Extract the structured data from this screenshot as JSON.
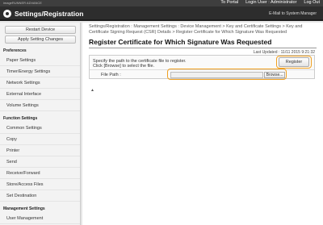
{
  "header": {
    "device_text": "imageRUNNER ADVANCE",
    "to_portal": "To Portal",
    "login_user_label": "Login User :",
    "login_user": "Administrator",
    "logout": "Log Out",
    "app_title": "Settings/Registration",
    "email_link": "E-Mail to System Manager"
  },
  "sidebar": {
    "restart_label": "Restart Device",
    "apply_label": "Apply Setting Changes",
    "sections": [
      {
        "title": "Preferences",
        "items": [
          "Paper Settings",
          "Timer/Energy Settings",
          "Network Settings",
          "External Interface",
          "Volume Settings"
        ]
      },
      {
        "title": "Function Settings",
        "items": [
          "Common Settings",
          "Copy",
          "Printer",
          "Send",
          "Receive/Forward",
          "Store/Access Files",
          "Set Destination"
        ]
      },
      {
        "title": "Management Settings",
        "items": [
          "User Management"
        ]
      }
    ]
  },
  "main": {
    "breadcrumb_line1": "Settings/Registration : Management Settings : Device Management > Key and Certificate Settings > Key and",
    "breadcrumb_line2": "Certificate Signing Request (CSR) Details > Register Certificate for Which Signature Was Requested",
    "page_title": "Register Certificate for Which Signature Was Requested",
    "last_updated": "Last Updated : 11/11 2015 9:21:32",
    "instruction_1": "Specify the path to the certificate file to register.",
    "instruction_2": "Click [Browse] to select the file.",
    "register_label": "Register",
    "file_path_label": "File Path :",
    "file_path_value": "",
    "browse_label": "Browse...",
    "top_icon_label": "▲"
  },
  "colors": {
    "highlight": "#f0a020",
    "appbar": "#2d2d2d",
    "topstrip": "#3e3e3e"
  }
}
